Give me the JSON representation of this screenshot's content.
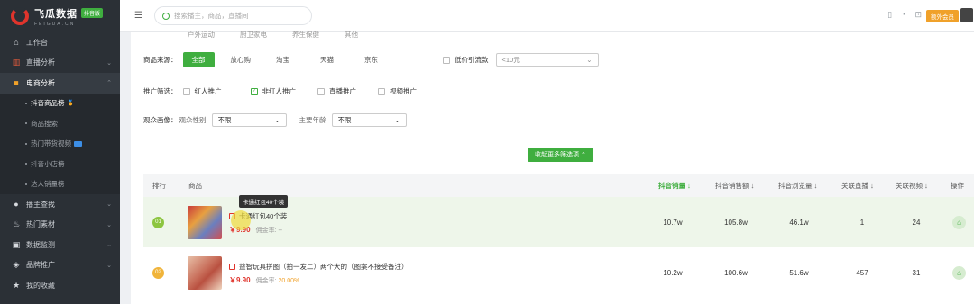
{
  "brand": {
    "name": "飞瓜数据",
    "sub": "FEIGUA.CN",
    "badge": "抖音版"
  },
  "sidebar": {
    "items": [
      {
        "label": "工作台",
        "icon": "home-icon"
      },
      {
        "label": "直播分析",
        "icon": "bar-chart-icon"
      },
      {
        "label": "电商分析",
        "icon": "shop-bag-icon"
      },
      {
        "label": "播主查找",
        "icon": "search-user-icon"
      },
      {
        "label": "热门素材",
        "icon": "flame-icon"
      },
      {
        "label": "数据监测",
        "icon": "monitor-icon"
      },
      {
        "label": "品牌推广",
        "icon": "brand-icon"
      },
      {
        "label": "我的收藏",
        "icon": "star-icon"
      }
    ],
    "sub_items": [
      {
        "label": "抖音商品榜"
      },
      {
        "label": "商品搜索"
      },
      {
        "label": "热门带货视频"
      },
      {
        "label": "抖音小店榜"
      },
      {
        "label": "达人销量榜"
      }
    ]
  },
  "topbar": {
    "search_placeholder": "搜索播主，商品，直播间",
    "upgrade_label": "额外会员"
  },
  "filters": {
    "cut_options": [
      "户外运动",
      "厨卫家电",
      "养生保健",
      "其他"
    ],
    "source_label": "商品来源：",
    "sources": [
      "全部",
      "放心购",
      "淘宝",
      "天猫",
      "京东"
    ],
    "low_price_label": "低价引流款",
    "low_price_value": "<10元",
    "promo_label": "推广筛选：",
    "promos": [
      {
        "label": "红人推广",
        "checked": false
      },
      {
        "label": "非红人推广",
        "checked": true
      },
      {
        "label": "直播推广",
        "checked": false
      },
      {
        "label": "视频推广",
        "checked": false
      }
    ],
    "audience_label": "观众画像：",
    "gender_label": "观众性别",
    "gender_value": "不限",
    "age_label": "主要年龄",
    "age_value": "不限",
    "collapse_label": "收起更多筛选项 ⌃"
  },
  "table": {
    "headers": {
      "rank": "排行",
      "product": "商品",
      "sales": "抖音销量 ↓",
      "revenue": "抖音销售额 ↓",
      "views": "抖音浏览量 ↓",
      "live": "关联直播 ↓",
      "videos": "关联视频 ↓",
      "action": "操作"
    },
    "rows": [
      {
        "rank": "01",
        "name": "卡通红包40个装",
        "price": "￥9.90",
        "commission": "佣金率: --",
        "sales": "10.7w",
        "revenue": "105.8w",
        "views": "46.1w",
        "live": "1",
        "videos": "24",
        "tooltip": "卡通红包40个装"
      },
      {
        "rank": "02",
        "name": "益智玩具拼图（拍一发二）两个大的（图案不接受备注）",
        "price": "￥9.90",
        "commission_label": "佣金率:",
        "commission_pct": "20.00%",
        "sales": "10.2w",
        "revenue": "100.6w",
        "views": "51.6w",
        "live": "457",
        "videos": "31"
      }
    ]
  },
  "colors": {
    "accent": "#3fae3f",
    "price": "#e0342c",
    "sidebar_bg": "#2b3036"
  }
}
